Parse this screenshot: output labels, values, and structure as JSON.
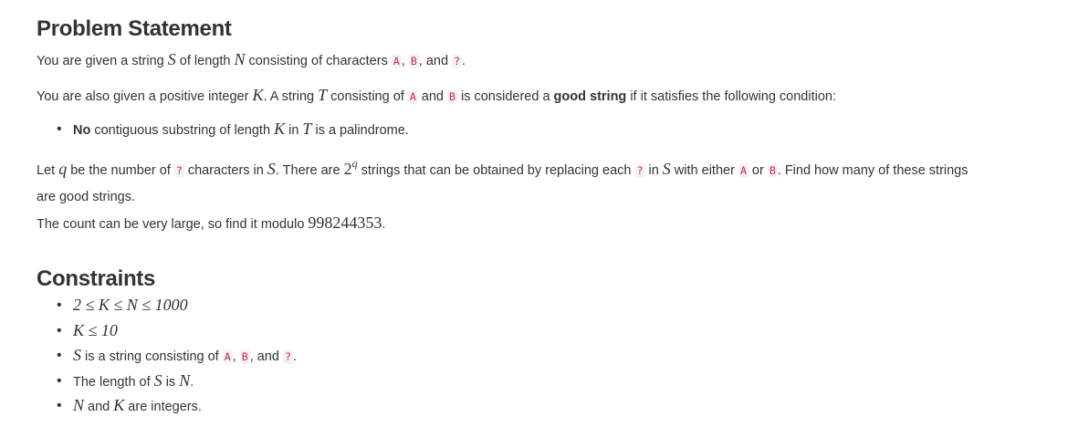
{
  "problem": {
    "title": "Problem Statement",
    "p1": {
      "t1": "You are given a string ",
      "m1": "S",
      "t2": " of length ",
      "m2": "N",
      "t3": " consisting of characters ",
      "c1": "A",
      "t4": ", ",
      "c2": "B",
      "t5": ", and ",
      "c3": "?",
      "t6": "."
    },
    "p2": {
      "t1": "You are also given a positive integer ",
      "m1": "K",
      "t2": ". A string ",
      "m2": "T",
      "t3": " consisting of ",
      "c1": "A",
      "t4": " and ",
      "c2": "B",
      "t5": " is considered a ",
      "b1": "good string",
      "t6": " if it satisfies the following condition:"
    },
    "condition": {
      "b1": "No",
      "t1": " contiguous substring of length ",
      "m1": "K",
      "t2": " in ",
      "m2": "T",
      "t3": " is a palindrome."
    },
    "p3": {
      "t1": "Let ",
      "m1": "q",
      "t2": " be the number of ",
      "c1": "?",
      "t3": " characters in ",
      "m2": "S",
      "t4": ". There are ",
      "m3": "2",
      "m3sup": "q",
      "t5": " strings that can be obtained by replacing each ",
      "c2": "?",
      "t6": " in ",
      "m4": "S",
      "t7": " with either ",
      "c3": "A",
      "t8": " or ",
      "c4": "B",
      "t9": ". Find how many of these strings",
      "t10": "are good strings."
    },
    "p4": {
      "t1": "The count can be very large, so find it modulo ",
      "m1": "998244353",
      "t2": "."
    }
  },
  "constraints": {
    "title": "Constraints",
    "c1": {
      "m1": "2 ≤ K ≤ N ≤ 1000"
    },
    "c2": {
      "m1": "K ≤ 10"
    },
    "c3": {
      "m1": "S",
      "t1": " is a string consisting of ",
      "c1": "A",
      "t2": ", ",
      "c2": "B",
      "t3": ", and ",
      "c3": "?",
      "t4": "."
    },
    "c4": {
      "t1": "The length of ",
      "m1": "S",
      "t2": " is ",
      "m2": "N",
      "t3": "."
    },
    "c5": {
      "m1": "N",
      "t1": " and ",
      "m2": "K",
      "t2": " are integers."
    }
  },
  "colors": {
    "text": "#333333",
    "code_text": "#c7254e",
    "code_bg": "#f9f2f4",
    "background": "#ffffff"
  }
}
